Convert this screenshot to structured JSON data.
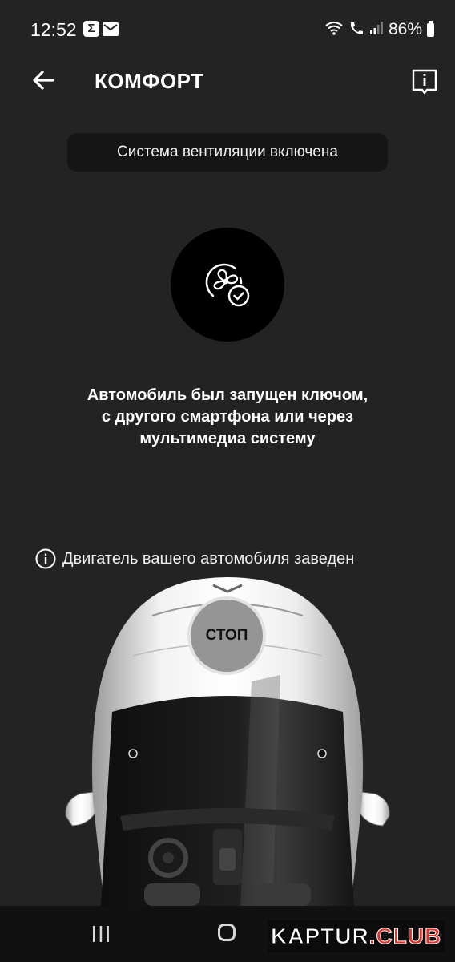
{
  "status_bar": {
    "time": "12:52",
    "app_icon_1": "Σ",
    "battery": "86%",
    "icons": [
      "sigma-icon",
      "mail-icon",
      "wifi-icon",
      "wifi-calling-icon",
      "signal-icon",
      "battery-icon"
    ]
  },
  "header": {
    "title": "КОМФОРТ",
    "back_icon": "arrow-left-icon",
    "info_icon": "info-icon"
  },
  "banner": {
    "text": "Система вентиляции включена"
  },
  "ventilation": {
    "icon": "fan-check-icon"
  },
  "message": {
    "line1": "Автомобиль был запущен ключом,",
    "line2": "с другого смартфона или через",
    "line3": "мультимедиа систему"
  },
  "engine_status": {
    "icon": "info-circle-icon",
    "text": "Двигатель вашего автомобиля заведен"
  },
  "stop_button": {
    "label": "СТОП"
  },
  "watermark": {
    "part1": "KAPTUR",
    "dot": ".",
    "part2": "CLUB"
  },
  "nav_bar": {
    "icons": [
      "recent-apps-icon",
      "home-icon"
    ]
  }
}
